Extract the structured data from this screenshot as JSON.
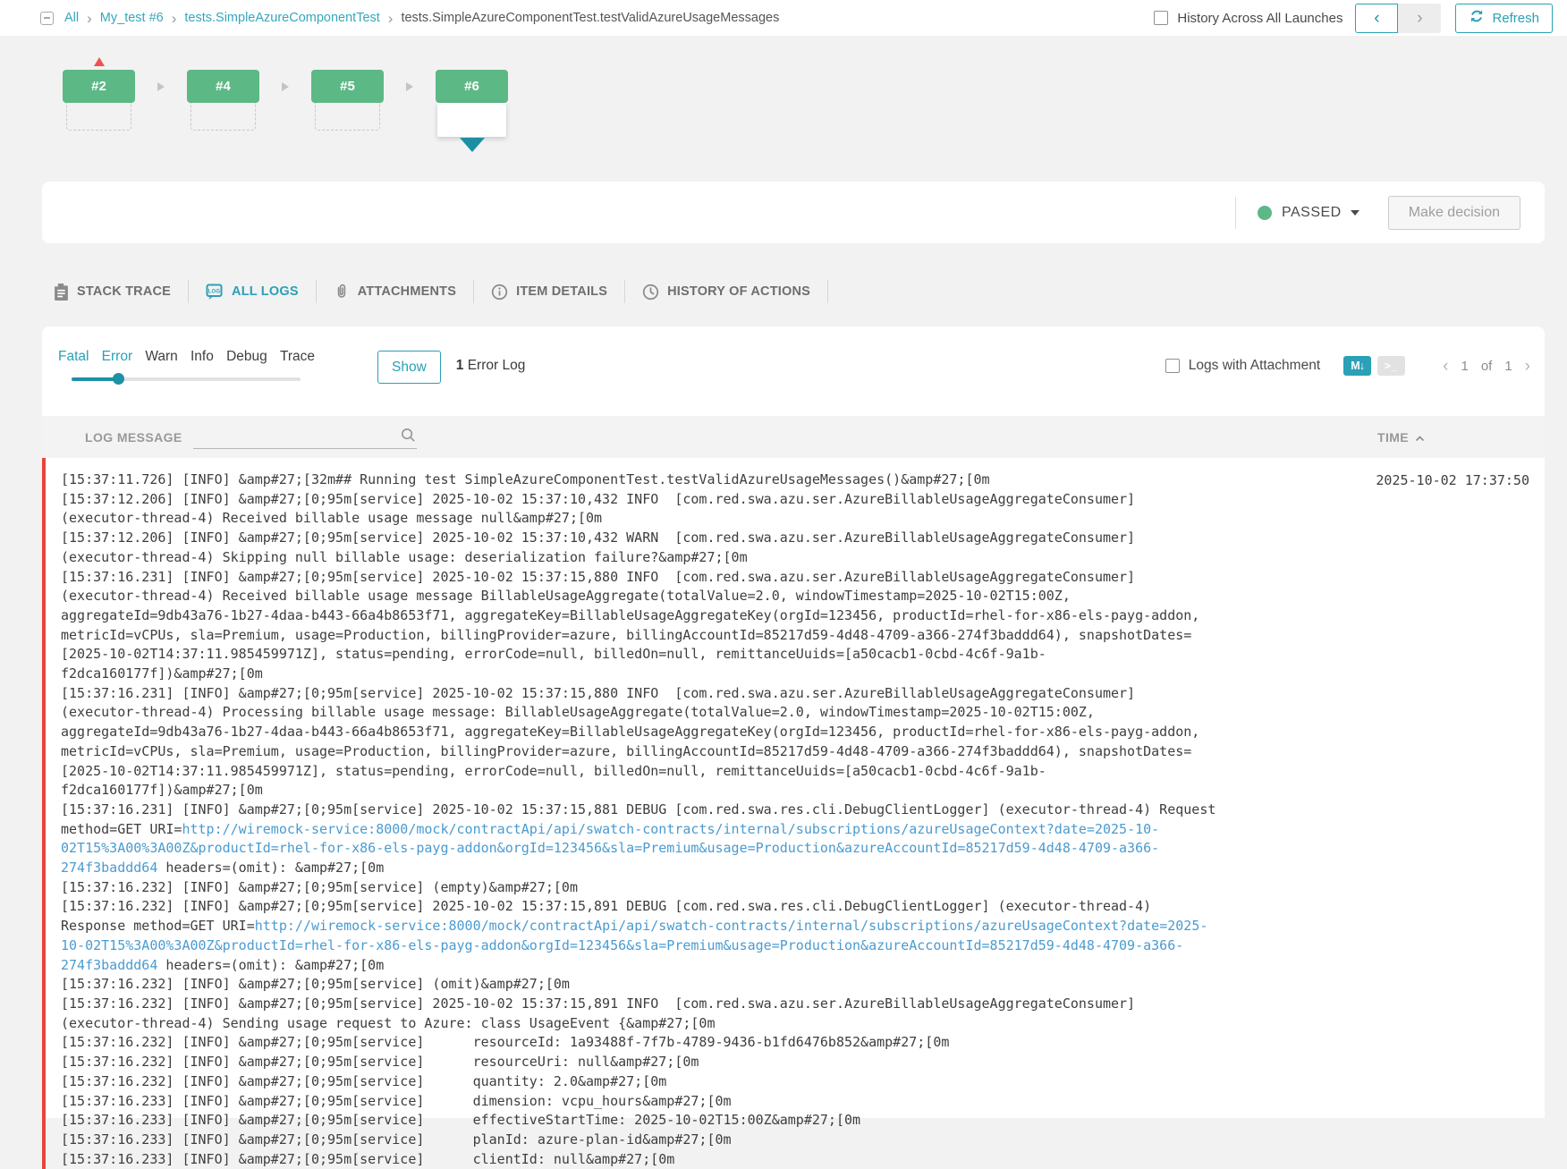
{
  "topbar": {
    "breadcrumb": [
      {
        "label": "All",
        "link": true
      },
      {
        "label": "My_test #6",
        "link": true
      },
      {
        "label": "tests.SimpleAzureComponentTest",
        "link": true
      },
      {
        "label": "tests.SimpleAzureComponentTest.testValidAzureUsageMessages",
        "link": false
      }
    ],
    "history_checkbox_label": "History Across All Launches",
    "refresh_label": "Refresh"
  },
  "history": {
    "items": [
      {
        "label": "#2",
        "flagged": true
      },
      {
        "label": "#4"
      },
      {
        "label": "#5"
      },
      {
        "label": "#6",
        "selected": true
      }
    ]
  },
  "status": {
    "value": "PASSED",
    "decision_label": "Make decision"
  },
  "tabs": [
    {
      "label": "STACK TRACE",
      "icon": "clipboard-icon",
      "id": "stack-trace"
    },
    {
      "label": "ALL LOGS",
      "icon": "log-file-icon",
      "id": "all-logs",
      "active": true
    },
    {
      "label": "ATTACHMENTS",
      "icon": "paperclip-icon",
      "id": "attachments"
    },
    {
      "label": "ITEM DETAILS",
      "icon": "info-icon",
      "id": "item-details"
    },
    {
      "label": "HISTORY OF ACTIONS",
      "icon": "clock-icon",
      "id": "history-of-actions"
    }
  ],
  "filterbar": {
    "levels": [
      {
        "label": "Fatal",
        "active": true
      },
      {
        "label": "Error",
        "active": true
      },
      {
        "label": "Warn"
      },
      {
        "label": "Info"
      },
      {
        "label": "Debug"
      },
      {
        "label": "Trace"
      }
    ],
    "show_label": "Show",
    "count": "1",
    "count_suffix": " Error Log",
    "attachment_label": "Logs with Attachment",
    "markdown_badge": "M↓",
    "console_badge": ">_",
    "page": {
      "current": "1",
      "of": "of",
      "total": "1"
    }
  },
  "table": {
    "message_header": "LOG MESSAGE",
    "time_header": "TIME"
  },
  "log": {
    "timestamp": "2025-10-02 17:37:50",
    "lines": [
      [
        {
          "text": "[15:37:11.726] [INFO] &amp#27;[32m## Running test SimpleAzureComponentTest.testValidAzureUsageMessages()&amp#27;[0m"
        }
      ],
      [
        {
          "text": "[15:37:12.206] [INFO] &amp#27;[0;95m[service] 2025-10-02 15:37:10,432 INFO  [com.red.swa.azu.ser.AzureBillableUsageAggregateConsumer] (executor-thread-4) Received billable usage message null&amp#27;[0m"
        }
      ],
      [
        {
          "text": "[15:37:12.206] [INFO] &amp#27;[0;95m[service] 2025-10-02 15:37:10,432 WARN  [com.red.swa.azu.ser.AzureBillableUsageAggregateConsumer] (executor-thread-4) Skipping null billable usage: deserialization failure?&amp#27;[0m"
        }
      ],
      [
        {
          "text": "[15:37:16.231] [INFO] &amp#27;[0;95m[service] 2025-10-02 15:37:15,880 INFO  [com.red.swa.azu.ser.AzureBillableUsageAggregateConsumer] (executor-thread-4) Received billable usage message BillableUsageAggregate(totalValue=2.0, windowTimestamp=2025-10-02T15:00Z, aggregateId=9db43a76-1b27-4daa-b443-66a4b8653f71, aggregateKey=BillableUsageAggregateKey(orgId=123456, productId=rhel-for-x86-els-payg-addon, metricId=vCPUs, sla=Premium, usage=Production, billingProvider=azure, billingAccountId=85217d59-4d48-4709-a366-274f3baddd64), snapshotDates=[2025-10-02T14:37:11.985459971Z], status=pending, errorCode=null, billedOn=null, remittanceUuids=[a50cacb1-0cbd-4c6f-9a1b-f2dca160177f])&amp#27;[0m"
        }
      ],
      [
        {
          "text": "[15:37:16.231] [INFO] &amp#27;[0;95m[service] 2025-10-02 15:37:15,880 INFO  [com.red.swa.azu.ser.AzureBillableUsageAggregateConsumer] (executor-thread-4) Processing billable usage message: BillableUsageAggregate(totalValue=2.0, windowTimestamp=2025-10-02T15:00Z, aggregateId=9db43a76-1b27-4daa-b443-66a4b8653f71, aggregateKey=BillableUsageAggregateKey(orgId=123456, productId=rhel-for-x86-els-payg-addon, metricId=vCPUs, sla=Premium, usage=Production, billingProvider=azure, billingAccountId=85217d59-4d48-4709-a366-274f3baddd64), snapshotDates=[2025-10-02T14:37:11.985459971Z], status=pending, errorCode=null, billedOn=null, remittanceUuids=[a50cacb1-0cbd-4c6f-9a1b-f2dca160177f])&amp#27;[0m"
        }
      ],
      [
        {
          "text": "[15:37:16.231] [INFO] &amp#27;[0;95m[service] 2025-10-02 15:37:15,881 DEBUG [com.red.swa.res.cli.DebugClientLogger] (executor-thread-4) Request method=GET URI="
        },
        {
          "text": "http://wiremock-service:8000/mock/contractApi/api/swatch-contracts/internal/subscriptions/azureUsageContext?date=2025-10-02T15%3A00%3A00Z&productId=rhel-for-x86-els-payg-addon&orgId=123456&sla=Premium&usage=Production&azureAccountId=85217d59-4d48-4709-a366-274f3baddd64",
          "link": true
        },
        {
          "text": " headers=(omit): &amp#27;[0m"
        }
      ],
      [
        {
          "text": "[15:37:16.232] [INFO] &amp#27;[0;95m[service] (empty)&amp#27;[0m"
        }
      ],
      [
        {
          "text": "[15:37:16.232] [INFO] &amp#27;[0;95m[service] 2025-10-02 15:37:15,891 DEBUG [com.red.swa.res.cli.DebugClientLogger] (executor-thread-4) Response method=GET URI="
        },
        {
          "text": "http://wiremock-service:8000/mock/contractApi/api/swatch-contracts/internal/subscriptions/azureUsageContext?date=2025-10-02T15%3A00%3A00Z&productId=rhel-for-x86-els-payg-addon&orgId=123456&sla=Premium&usage=Production&azureAccountId=85217d59-4d48-4709-a366-274f3baddd64",
          "link": true
        },
        {
          "text": " headers=(omit): &amp#27;[0m"
        }
      ],
      [
        {
          "text": "[15:37:16.232] [INFO] &amp#27;[0;95m[service] (omit)&amp#27;[0m"
        }
      ],
      [
        {
          "text": "[15:37:16.232] [INFO] &amp#27;[0;95m[service] 2025-10-02 15:37:15,891 INFO  [com.red.swa.azu.ser.AzureBillableUsageAggregateConsumer] (executor-thread-4) Sending usage request to Azure: class UsageEvent {&amp#27;[0m"
        }
      ],
      [
        {
          "text": "[15:37:16.232] [INFO] &amp#27;[0;95m[service]      resourceId: 1a93488f-7f7b-4789-9436-b1fd6476b852&amp#27;[0m"
        }
      ],
      [
        {
          "text": "[15:37:16.232] [INFO] &amp#27;[0;95m[service]      resourceUri: null&amp#27;[0m"
        }
      ],
      [
        {
          "text": "[15:37:16.232] [INFO] &amp#27;[0;95m[service]      quantity: 2.0&amp#27;[0m"
        }
      ],
      [
        {
          "text": "[15:37:16.233] [INFO] &amp#27;[0;95m[service]      dimension: vcpu_hours&amp#27;[0m"
        }
      ],
      [
        {
          "text": "[15:37:16.233] [INFO] &amp#27;[0;95m[service]      effectiveStartTime: 2025-10-02T15:00Z&amp#27;[0m"
        }
      ],
      [
        {
          "text": "[15:37:16.233] [INFO] &amp#27;[0;95m[service]      planId: azure-plan-id&amp#27;[0m"
        }
      ],
      [
        {
          "text": "[15:37:16.233] [INFO] &amp#27;[0;95m[service]      clientId: null&amp#27;[0m"
        }
      ]
    ]
  }
}
